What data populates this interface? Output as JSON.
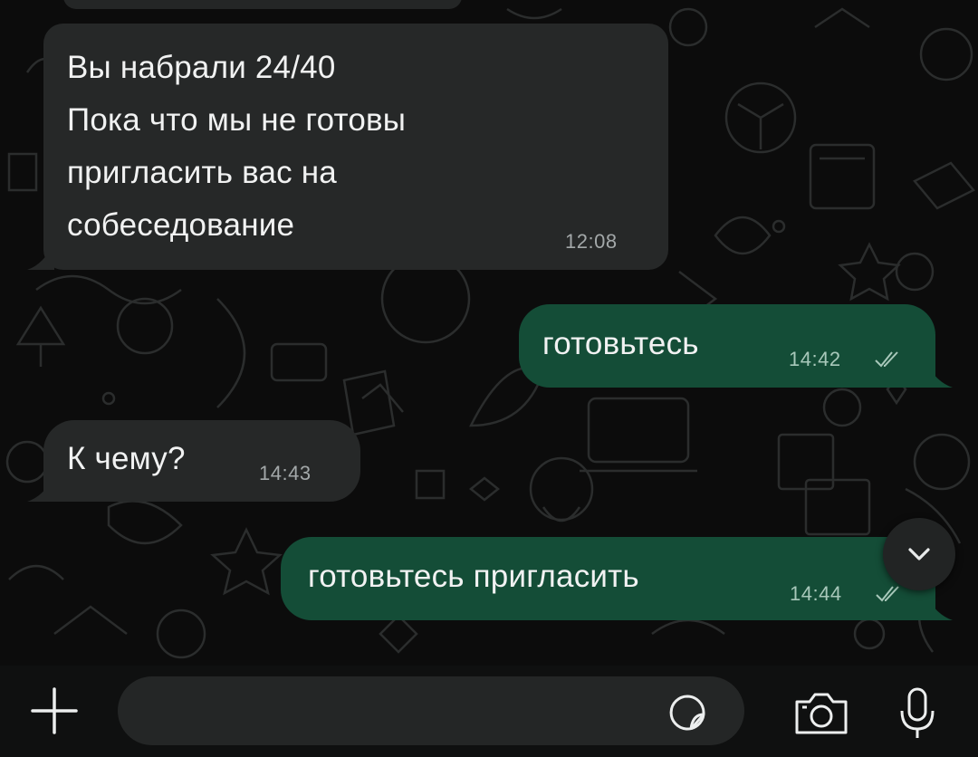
{
  "messages": [
    {
      "direction": "incoming",
      "text": "Вы набрали 24/40\nПока что мы не готовы\nпригласить вас на\nсобеседование",
      "time": "12:08"
    },
    {
      "direction": "outgoing",
      "text": "готовьтесь",
      "time": "14:42",
      "status": "read"
    },
    {
      "direction": "incoming",
      "text": "К чему?",
      "time": "14:43"
    },
    {
      "direction": "outgoing",
      "text": "готовьтесь пригласить",
      "time": "14:44",
      "status": "read"
    }
  ],
  "input_bar": {
    "icons": [
      "plus-icon",
      "sticker-icon",
      "camera-icon",
      "microphone-icon"
    ]
  },
  "colors": {
    "incoming_bubble": "#262828",
    "outgoing_bubble": "#144d37",
    "background": "#0c0c0c"
  }
}
